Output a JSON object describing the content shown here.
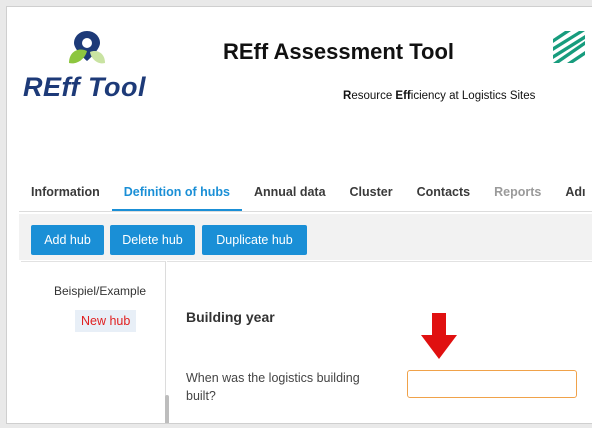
{
  "header": {
    "logo_text": "REff Tool",
    "title": "REff Assessment Tool",
    "subtitle_parts": [
      "R",
      "esource ",
      "Eff",
      "iciency at Logistics Sites"
    ]
  },
  "tabs": [
    {
      "label": "Information",
      "state": "normal"
    },
    {
      "label": "Definition of hubs",
      "state": "active"
    },
    {
      "label": "Annual data",
      "state": "normal"
    },
    {
      "label": "Cluster",
      "state": "normal"
    },
    {
      "label": "Contacts",
      "state": "normal"
    },
    {
      "label": "Reports",
      "state": "disabled"
    },
    {
      "label": "Adı",
      "state": "normal"
    }
  ],
  "toolbar": {
    "add_label": "Add hub",
    "delete_label": "Delete hub",
    "duplicate_label": "Duplicate hub"
  },
  "sidebar": {
    "example_label": "Beispiel/Example",
    "new_hub_label": "New hub"
  },
  "content": {
    "section_title": "Building year",
    "question": "When was the logistics building built?",
    "building_year_value": ""
  },
  "colors": {
    "accent": "#1a8fd6",
    "new_hub_text": "#e02020",
    "input_border": "#f0a24a",
    "arrow": "#e01010",
    "logo_text": "#1d3a78"
  },
  "icons": [
    "location-pin-leaf-icon",
    "partner-logo-icon",
    "down-arrow-icon"
  ]
}
